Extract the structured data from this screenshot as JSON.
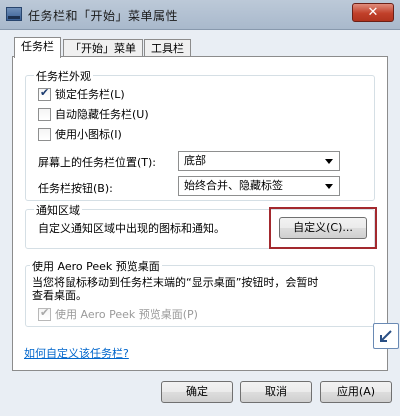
{
  "window": {
    "title": "任务栏和「开始」菜单属性",
    "close_label": "✕"
  },
  "tabs": [
    {
      "label": "任务栏"
    },
    {
      "label": "「开始」菜单"
    },
    {
      "label": "工具栏"
    }
  ],
  "appearance": {
    "title": "任务栏外观",
    "options": [
      {
        "label": "锁定任务栏(L)",
        "checked": true
      },
      {
        "label": "自动隐藏任务栏(U)",
        "checked": false
      },
      {
        "label": "使用小图标(I)",
        "checked": false
      }
    ],
    "position_label": "屏幕上的任务栏位置(T):",
    "position_value": "底部",
    "buttons_label": "任务栏按钮(B):",
    "buttons_value": "始终合并、隐藏标签"
  },
  "notify": {
    "title": "通知区域",
    "description": "自定义通知区域中出现的图标和通知。",
    "customize_label": "自定义(C)..."
  },
  "peek": {
    "title": "使用 Aero Peek 预览桌面",
    "description_line1": "当您将鼠标移动到任务栏末端的“显示桌面”按钮时，会暂时",
    "description_line2": "查看桌面。",
    "option_label": "使用 Aero Peek 预览桌面(P)",
    "option_checked": true
  },
  "help_link": "如何自定义该任务栏?",
  "footer": {
    "ok": "确定",
    "cancel": "取消",
    "apply": "应用(A)"
  },
  "colors": {
    "highlight": "#a3292e",
    "link": "#0066cc"
  }
}
